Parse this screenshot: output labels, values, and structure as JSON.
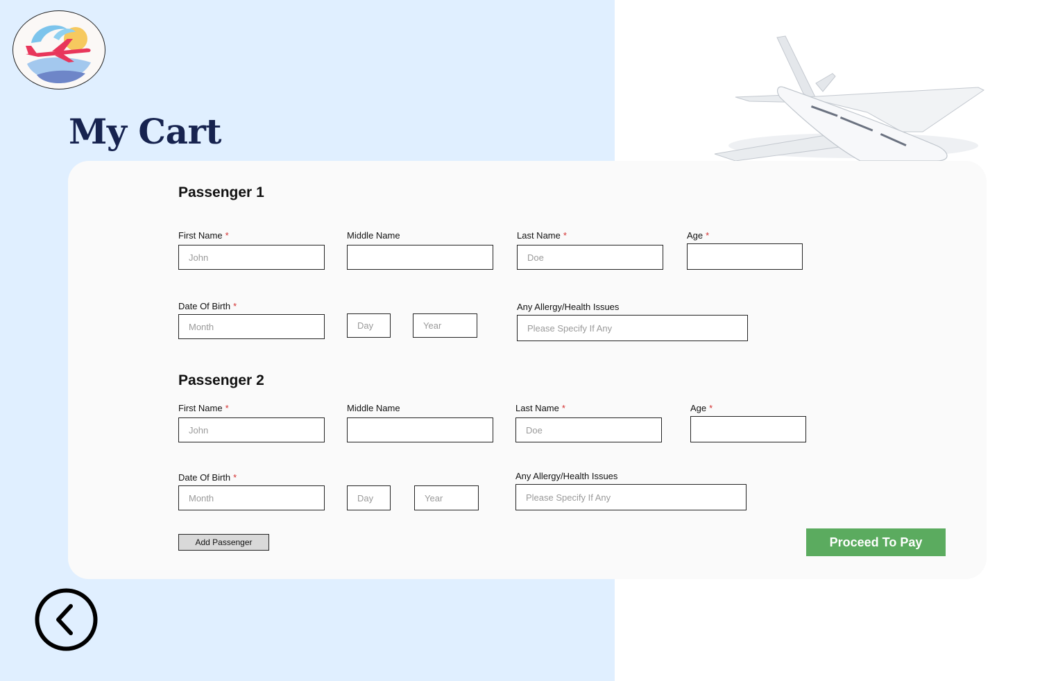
{
  "page": {
    "title": "My Cart"
  },
  "colors": {
    "left_background": "#e0efff",
    "title": "#17234f",
    "card_background": "#fafafa",
    "required_star": "#d32f2f",
    "proceed_button": "#5bab5f",
    "add_button": "#d9d9d9"
  },
  "icons": {
    "logo": "airplane-sun-logo-icon",
    "hero": "airplane-illustration",
    "back": "chevron-left-circle-icon"
  },
  "passengers": [
    {
      "title": "Passenger 1",
      "first_name": {
        "label": "First Name",
        "required": "*",
        "value": "",
        "placeholder": "John"
      },
      "middle_name": {
        "label": "Middle Name",
        "value": "",
        "placeholder": ""
      },
      "last_name": {
        "label": "Last Name",
        "required": "*",
        "value": "",
        "placeholder": "Doe"
      },
      "age": {
        "label": "Age",
        "required": "*",
        "value": "",
        "placeholder": ""
      },
      "dob": {
        "label": "Date Of Birth",
        "required": "*",
        "month_placeholder": "Month",
        "day_placeholder": "Day",
        "year_placeholder": "Year"
      },
      "allergy": {
        "label": "Any Allergy/Health Issues",
        "value": "",
        "placeholder": "Please Specify If Any"
      }
    },
    {
      "title": "Passenger 2",
      "first_name": {
        "label": "First Name",
        "required": "*",
        "value": "",
        "placeholder": "John"
      },
      "middle_name": {
        "label": "Middle Name",
        "value": "",
        "placeholder": ""
      },
      "last_name": {
        "label": "Last Name",
        "required": "*",
        "value": "",
        "placeholder": "Doe"
      },
      "age": {
        "label": "Age",
        "required": "*",
        "value": "",
        "placeholder": ""
      },
      "dob": {
        "label": "Date Of Birth",
        "required": "*",
        "month_placeholder": "Month",
        "day_placeholder": "Day",
        "year_placeholder": "Year"
      },
      "allergy": {
        "label": "Any Allergy/Health Issues",
        "value": "",
        "placeholder": "Please Specify If Any"
      }
    }
  ],
  "actions": {
    "add_passenger_label": "Add Passenger",
    "proceed_label": "Proceed To Pay"
  }
}
